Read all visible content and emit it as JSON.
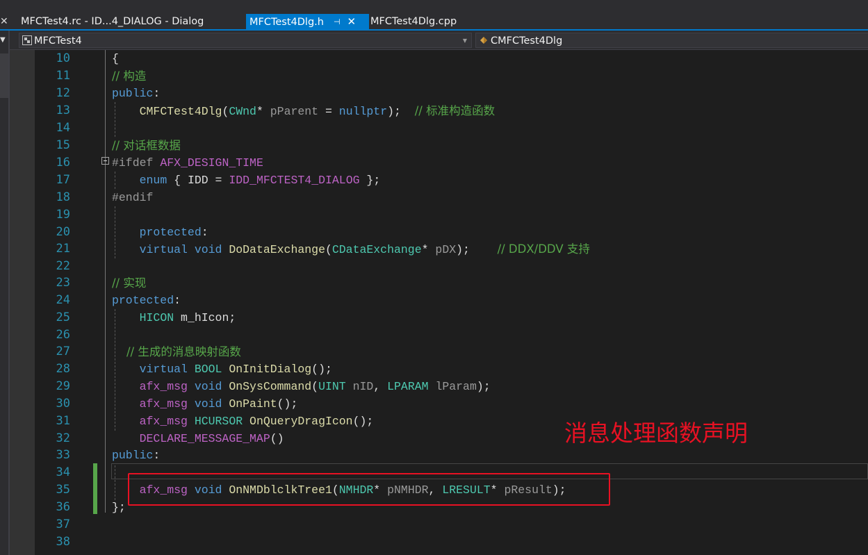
{
  "tabs": [
    {
      "label": "MFCTest4.rc - ID...4_DIALOG - Dialog",
      "active": false
    },
    {
      "label": "MFCTest4Dlg.h",
      "active": true,
      "pin_icon": "pin-icon",
      "close_icon": "close-icon"
    },
    {
      "label": "MFCTest4Dlg.cpp",
      "active": false
    }
  ],
  "navbar": {
    "project": "MFCTest4",
    "class_scope": "CMFCTest4Dlg"
  },
  "editor": {
    "line_numbers": [
      "10",
      "11",
      "12",
      "13",
      "14",
      "15",
      "16",
      "17",
      "18",
      "19",
      "20",
      "21",
      "22",
      "23",
      "24",
      "25",
      "26",
      "27",
      "28",
      "29",
      "30",
      "31",
      "32",
      "33",
      "34",
      "35",
      "36",
      "37",
      "38"
    ],
    "lines": [
      "{",
      "// 构造",
      "public:",
      "    CMFCTest4Dlg(CWnd* pParent = nullptr);  // 标准构造函数",
      "",
      "// 对话框数据",
      "#ifdef AFX_DESIGN_TIME",
      "    enum { IDD = IDD_MFCTEST4_DIALOG };",
      "#endif",
      "",
      "    protected:",
      "    virtual void DoDataExchange(CDataExchange* pDX);    // DDX/DDV 支持",
      "",
      "// 实现",
      "protected:",
      "    HICON m_hIcon;",
      "",
      "    // 生成的消息映射函数",
      "    virtual BOOL OnInitDialog();",
      "    afx_msg void OnSysCommand(UINT nID, LPARAM lParam);",
      "    afx_msg void OnPaint();",
      "    afx_msg HCURSOR OnQueryDragIcon();",
      "    DECLARE_MESSAGE_MAP()",
      "public:",
      "",
      "    afx_msg void OnNMDblclkTree1(NMHDR* pNMHDR, LRESULT* pResult);",
      "};",
      "",
      ""
    ]
  },
  "annotation": {
    "text": "消息处理函数声明",
    "color": "#e81123"
  },
  "colors": {
    "background": "#1e1e1e",
    "keyword": "#569cd6",
    "type": "#4ec9b0",
    "function": "#dcdcaa",
    "macro": "#bd63c5",
    "comment": "#57a64a",
    "line_number": "#2b91af",
    "accent": "#007acc"
  }
}
